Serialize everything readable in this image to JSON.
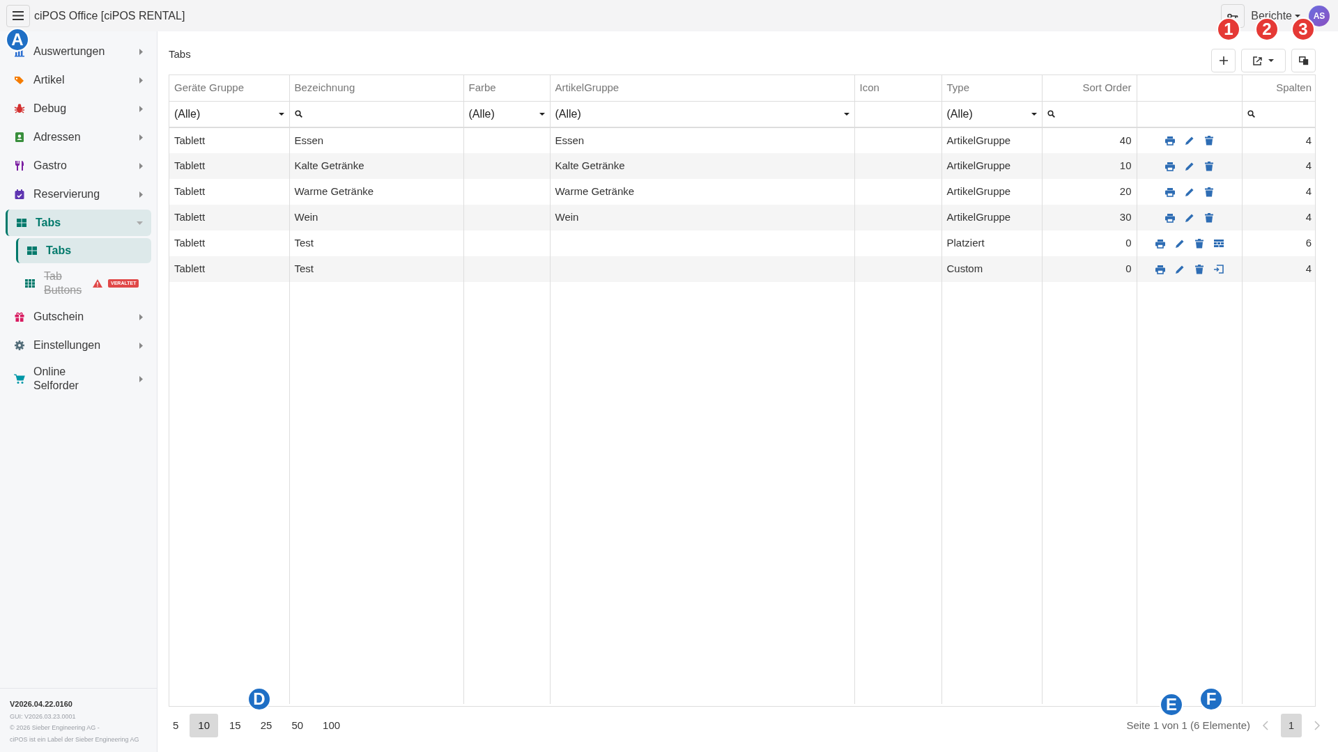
{
  "app_title": "ciPOS Office [ciPOS RENTAL]",
  "header": {
    "reports_label": "Berichte",
    "avatar": "AS"
  },
  "sidebar": {
    "items": [
      {
        "label": "Auswertungen",
        "color": "#2b6fd1",
        "expanded": false,
        "selected": false
      },
      {
        "label": "Artikel",
        "color": "#f57c00",
        "expanded": false,
        "selected": false
      },
      {
        "label": "Debug",
        "color": "#d32f2f",
        "expanded": false,
        "selected": false
      },
      {
        "label": "Adressen",
        "color": "#388e3c",
        "expanded": false,
        "selected": false
      },
      {
        "label": "Gastro",
        "color": "#7b1fa2",
        "expanded": false,
        "selected": false
      },
      {
        "label": "Reservierung",
        "color": "#5e35b1",
        "expanded": false,
        "selected": false
      },
      {
        "label": "Tabs",
        "color": "#00796b",
        "expanded": true,
        "selected": true,
        "children": [
          {
            "label": "Tabs",
            "color": "#00796b",
            "selected": true,
            "deprecated": false
          },
          {
            "label": "Tab Buttons",
            "color": "#00796b",
            "selected": false,
            "deprecated": true,
            "badge": "VERALTET"
          }
        ]
      },
      {
        "label": "Gutschein",
        "color": "#d81b60",
        "expanded": false,
        "selected": false
      },
      {
        "label": "Einstellungen",
        "color": "#546e7a",
        "expanded": false,
        "selected": false
      },
      {
        "label": "Online Selforder",
        "color": "#0097a7",
        "expanded": false,
        "selected": false
      }
    ],
    "footer": {
      "version": "V2026.04.22.0160",
      "gui_version": "GUI: V2026.03.23.0001",
      "copyright": "© 2026 Sieber Engineering AG -",
      "label_note": "ciPOS ist ein Label der Sieber Engineering AG"
    }
  },
  "page_title": "Tabs",
  "table": {
    "columns": [
      {
        "label": "Geräte Gruppe",
        "filter_value": "(Alle)"
      },
      {
        "label": "Bezeichnung"
      },
      {
        "label": "Farbe",
        "filter_value": "(Alle)"
      },
      {
        "label": "ArtikelGruppe",
        "filter_value": "(Alle)"
      },
      {
        "label": "Icon"
      },
      {
        "label": "Type",
        "filter_value": "(Alle)"
      },
      {
        "label": "Sort Order"
      },
      {},
      {
        "label": "Spalten"
      }
    ],
    "rows": [
      {
        "geraete_gruppe": "Tablett",
        "bezeichnung": "Essen",
        "artikelgruppe": "Essen",
        "type": "ArtikelGruppe",
        "sort_order": "40",
        "actions": [
          {
            "kind": "print"
          },
          {
            "kind": "edit"
          },
          {
            "kind": "delete"
          }
        ],
        "spalten": "4"
      },
      {
        "geraete_gruppe": "Tablett",
        "bezeichnung": "Kalte Getränke",
        "artikelgruppe": "Kalte Getränke",
        "type": "ArtikelGruppe",
        "sort_order": "10",
        "actions": [
          {
            "kind": "print"
          },
          {
            "kind": "edit"
          },
          {
            "kind": "delete"
          }
        ],
        "spalten": "4"
      },
      {
        "geraete_gruppe": "Tablett",
        "bezeichnung": "Warme Getränke",
        "artikelgruppe": "Warme Getränke",
        "type": "ArtikelGruppe",
        "sort_order": "20",
        "actions": [
          {
            "kind": "print"
          },
          {
            "kind": "edit"
          },
          {
            "kind": "delete"
          }
        ],
        "spalten": "4"
      },
      {
        "geraete_gruppe": "Tablett",
        "bezeichnung": "Wein",
        "artikelgruppe": "Wein",
        "type": "ArtikelGruppe",
        "sort_order": "30",
        "actions": [
          {
            "kind": "print"
          },
          {
            "kind": "edit"
          },
          {
            "kind": "delete"
          }
        ],
        "spalten": "4"
      },
      {
        "geraete_gruppe": "Tablett",
        "bezeichnung": "Test",
        "type": "Platziert",
        "sort_order": "0",
        "actions": [
          {
            "kind": "print"
          },
          {
            "kind": "edit"
          },
          {
            "kind": "delete"
          },
          {
            "kind": "layout"
          }
        ],
        "spalten": "6"
      },
      {
        "geraete_gruppe": "Tablett",
        "bezeichnung": "Test",
        "type": "Custom",
        "sort_order": "0",
        "actions": [
          {
            "kind": "print"
          },
          {
            "kind": "edit"
          },
          {
            "kind": "delete"
          },
          {
            "kind": "custom"
          }
        ],
        "spalten": "4"
      }
    ]
  },
  "pager": {
    "page_sizes": [
      {
        "label": "5",
        "selected": false
      },
      {
        "label": "10",
        "selected": true
      },
      {
        "label": "15",
        "selected": false
      },
      {
        "label": "25",
        "selected": false
      },
      {
        "label": "50",
        "selected": false
      },
      {
        "label": "100",
        "selected": false
      }
    ],
    "info": "Seite 1 von 1 (6 Elemente)",
    "pages": [
      {
        "label": "1",
        "selected": true
      }
    ]
  },
  "callouts": [
    {
      "label": "A",
      "color": "#1f6fc5"
    },
    {
      "label": "1",
      "color": "#e53935"
    },
    {
      "label": "2",
      "color": "#e53935"
    },
    {
      "label": "3",
      "color": "#e53935"
    },
    {
      "label": "D",
      "color": "#1f6fc5"
    },
    {
      "label": "E",
      "color": "#1f6fc5"
    },
    {
      "label": "F",
      "color": "#1f6fc5"
    }
  ]
}
